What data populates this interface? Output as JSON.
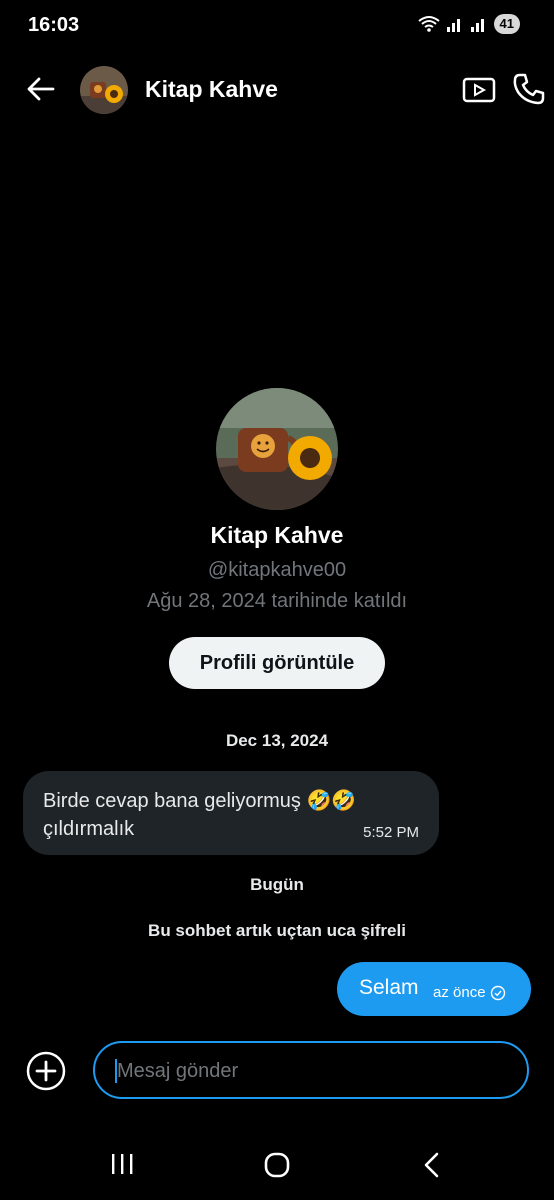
{
  "status_bar": {
    "time": "16:03",
    "battery": "41"
  },
  "header": {
    "name": "Kitap Kahve"
  },
  "profile": {
    "name": "Kitap Kahve",
    "handle": "@kitapkahve00",
    "joined": "Ağu 28, 2024 tarihinde katıldı",
    "view_button": "Profili görüntüle"
  },
  "messages": {
    "date_1": "Dec 13, 2024",
    "incoming": {
      "text": "Birde cevap bana geliyormuş 🤣🤣 çıldırmalık",
      "time": "5:52 PM"
    },
    "date_2": "Bugün",
    "encryption_notice": "Bu sohbet artık uçtan uca şifreli",
    "outgoing": {
      "text": "Selam",
      "time": "az önce"
    }
  },
  "composer": {
    "placeholder": "Mesaj gönder"
  },
  "colors": {
    "accent": "#1d9bf0",
    "incoming_bubble": "#1e2428",
    "background": "#000000"
  }
}
